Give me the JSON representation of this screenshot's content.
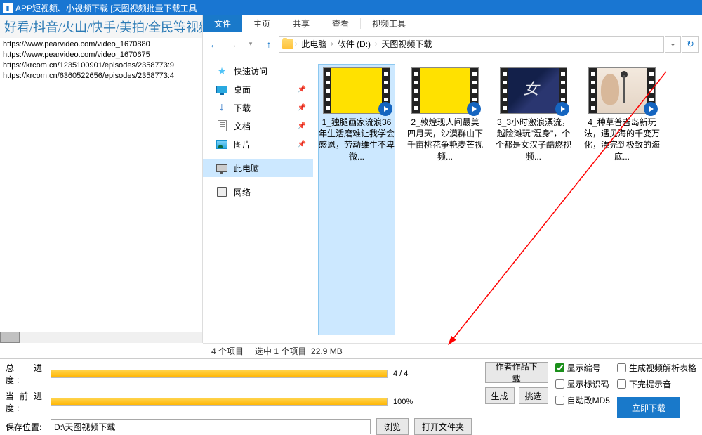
{
  "titlebar": {
    "text": "APP短视频、小视频下载 [天图视频批量下载工具"
  },
  "left": {
    "header": "好看/抖音/火山/快手/美拍/全民等视频",
    "urls": [
      "https://www.pearvideo.com/video_1670880",
      "https://www.pearvideo.com/video_1670675",
      "https://krcom.cn/1235100901/episodes/2358773:9",
      "https://krcom.cn/6360522656/episodes/2358773:4"
    ]
  },
  "ribbon": {
    "file": "文件",
    "home": "主页",
    "share": "共享",
    "view": "查看",
    "video": "视频工具"
  },
  "path": {
    "root": "此电脑",
    "drive": "软件 (D:)",
    "folder": "天图视频下载"
  },
  "tree": {
    "quick": "快速访问",
    "desktop": "桌面",
    "downloads": "下载",
    "docs": "文档",
    "pics": "图片",
    "pc": "此电脑",
    "net": "网络"
  },
  "files": [
    {
      "name": "1_独腿画家流浪36年生活磨难让我学会感恩，劳动维生不卑微..."
    },
    {
      "name": "2_敦煌现人间最美四月天，沙漠群山下千亩桃花争艳麦芒视频..."
    },
    {
      "name": "3_3小时激浪漂流，越险滩玩\"湿身\"，个个都是女汉子酷燃视频..."
    },
    {
      "name": "4_种草普吉岛新玩法，遇见海的千变万化，漂完到极致的海底..."
    }
  ],
  "status": {
    "count": "4 个项目",
    "selected": "选中 1 个项目",
    "size": "22.9 MB"
  },
  "bottom": {
    "total_label": "总 进 度:",
    "total_pct": "4 / 4",
    "cur_label": "当前进度:",
    "cur_pct": "100%",
    "loc_label": "保存位置:",
    "loc_value": "D:\\天图视频下载",
    "browse": "浏览",
    "open_folder": "打开文件夹",
    "author_dl": "作者作品下载",
    "gen": "生成",
    "pick": "挑选",
    "show_num": "显示编号",
    "show_id": "显示标识码",
    "auto_md5": "自动改MD5",
    "gen_sheet": "生成视频解析表格",
    "no_finish_sound": "下完提示音",
    "download_now": "立即下载"
  }
}
